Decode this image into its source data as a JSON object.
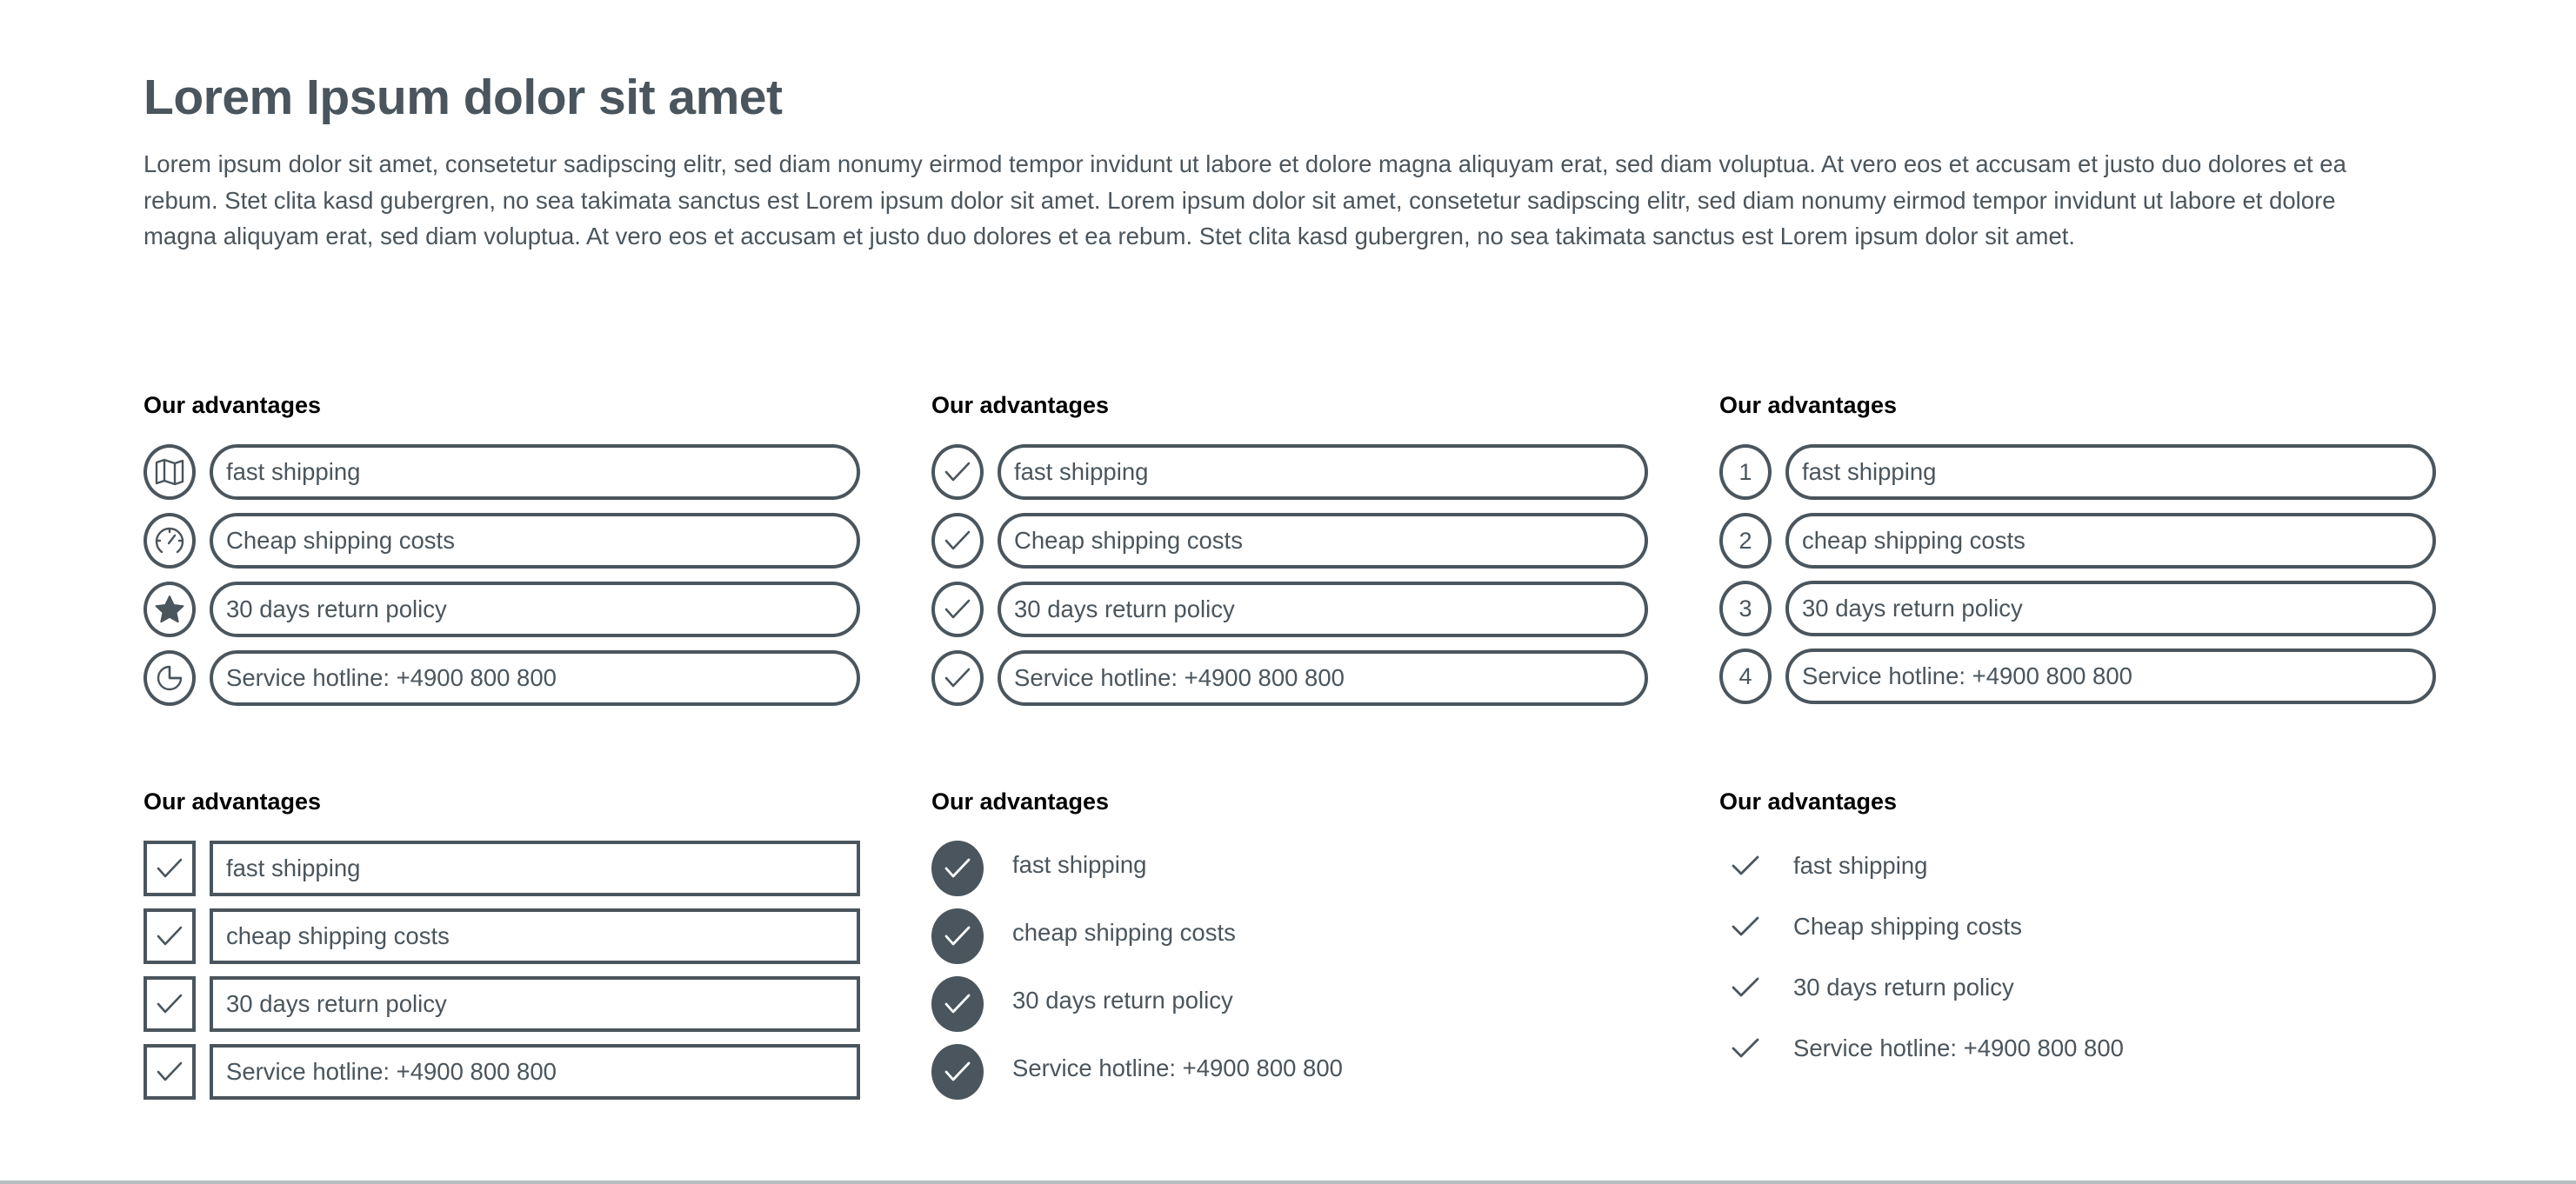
{
  "page": {
    "title": "Lorem Ipsum dolor sit amet",
    "intro": "Lorem ipsum dolor sit amet, consetetur sadipscing elitr, sed diam nonumy eirmod tempor invidunt ut labore et dolore magna aliquyam erat, sed diam voluptua. At vero eos et accusam et justo duo dolores et ea rebum. Stet clita kasd gubergren, no sea takimata sanctus est Lorem ipsum dolor sit amet. Lorem ipsum dolor sit amet, consetetur sadipscing elitr, sed diam nonumy eirmod tempor invidunt ut labore et dolore magna aliquyam erat, sed diam voluptua. At vero eos et accusam et justo duo dolores et ea rebum. Stet clita kasd gubergren, no sea takimata sanctus est Lorem ipsum dolor sit amet."
  },
  "colors": {
    "primary": "#4a555d",
    "heading": "#000000",
    "divider": "#b8bdc1",
    "background": "#ffffff"
  },
  "cards": [
    {
      "heading": "Our advantages",
      "style": "icon-circle-pill",
      "items": [
        {
          "icon": "map-icon",
          "label": "fast shipping"
        },
        {
          "icon": "speedometer-icon",
          "label": "Cheap shipping costs"
        },
        {
          "icon": "star-icon",
          "label": "30 days return policy"
        },
        {
          "icon": "pie-chart-icon",
          "label": "Service hotline: +4900 800 800"
        }
      ]
    },
    {
      "heading": "Our advantages",
      "style": "check-circle-pill",
      "items": [
        {
          "icon": "check-icon",
          "label": "fast shipping"
        },
        {
          "icon": "check-icon",
          "label": "Cheap shipping costs"
        },
        {
          "icon": "check-icon",
          "label": "30 days return policy"
        },
        {
          "icon": "check-icon",
          "label": "Service hotline: +4900 800 800"
        }
      ]
    },
    {
      "heading": "Our advantages",
      "style": "number-circle-pill",
      "items": [
        {
          "number": "1",
          "label": "fast shipping"
        },
        {
          "number": "2",
          "label": "cheap shipping costs"
        },
        {
          "number": "3",
          "label": "30 days return policy"
        },
        {
          "number": "4",
          "label": "Service hotline: +4900 800 800"
        }
      ]
    },
    {
      "heading": "Our advantages",
      "style": "check-square-box",
      "items": [
        {
          "icon": "check-icon",
          "label": "fast shipping"
        },
        {
          "icon": "check-icon",
          "label": "cheap shipping costs"
        },
        {
          "icon": "check-icon",
          "label": "30 days return policy"
        },
        {
          "icon": "check-icon",
          "label": "Service hotline: +4900 800 800"
        }
      ]
    },
    {
      "heading": "Our advantages",
      "style": "filled-check-circle",
      "items": [
        {
          "icon": "check-circle-filled-icon",
          "label": "fast shipping"
        },
        {
          "icon": "check-circle-filled-icon",
          "label": "cheap shipping costs"
        },
        {
          "icon": "check-circle-filled-icon",
          "label": "30 days return policy"
        },
        {
          "icon": "check-circle-filled-icon",
          "label": "Service hotline: +4900 800 800"
        }
      ]
    },
    {
      "heading": "Our advantages",
      "style": "plain-check",
      "items": [
        {
          "icon": "check-icon",
          "label": "fast shipping"
        },
        {
          "icon": "check-icon",
          "label": "Cheap shipping costs"
        },
        {
          "icon": "check-icon",
          "label": "30 days return policy"
        },
        {
          "icon": "check-icon",
          "label": "Service hotline: +4900 800 800"
        }
      ]
    }
  ]
}
